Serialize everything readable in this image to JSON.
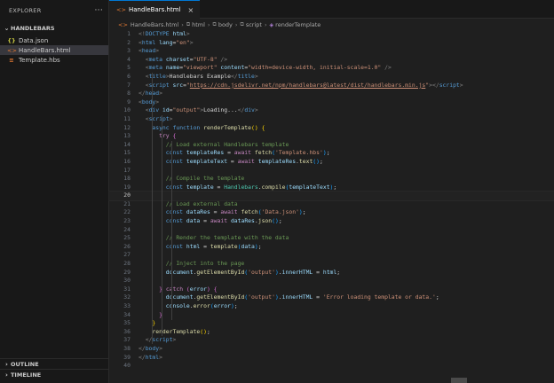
{
  "explorer": {
    "title": "EXPLORER",
    "more": "···",
    "folder": "HANDLEBARS",
    "files": [
      {
        "name": "Data.json",
        "icon": "{}",
        "kind": "json"
      },
      {
        "name": "HandleBars.html",
        "icon": "<>",
        "kind": "html"
      },
      {
        "name": "Template.hbs",
        "icon": "≡",
        "kind": "hbs"
      }
    ],
    "outline": "OUTLINE",
    "timeline": "TIMELINE"
  },
  "tab": {
    "label": "HandleBars.html",
    "icon": "<>",
    "close": "×"
  },
  "breadcrumb": [
    "HandleBars.html",
    "html",
    "body",
    "script",
    "renderTemplate"
  ],
  "current_line": 20,
  "code": [
    [
      [
        "br",
        "<!"
      ],
      [
        "tag",
        "DOCTYPE"
      ],
      [
        "pn",
        " "
      ],
      [
        "attr",
        "html"
      ],
      [
        "br",
        ">"
      ]
    ],
    [
      [
        "br",
        "<"
      ],
      [
        "tag",
        "html"
      ],
      [
        "pn",
        " "
      ],
      [
        "attr",
        "lang"
      ],
      [
        "pn",
        "="
      ],
      [
        "str",
        "\"en\""
      ],
      [
        "br",
        ">"
      ]
    ],
    [
      [
        "br",
        "<"
      ],
      [
        "tag",
        "head"
      ],
      [
        "br",
        ">"
      ]
    ],
    [
      [
        "pn",
        "  "
      ],
      [
        "br",
        "<"
      ],
      [
        "tag",
        "meta"
      ],
      [
        "pn",
        " "
      ],
      [
        "attr",
        "charset"
      ],
      [
        "pn",
        "="
      ],
      [
        "str",
        "\"UTF-8\""
      ],
      [
        "pn",
        " "
      ],
      [
        "br",
        "/>"
      ]
    ],
    [
      [
        "pn",
        "  "
      ],
      [
        "br",
        "<"
      ],
      [
        "tag",
        "meta"
      ],
      [
        "pn",
        " "
      ],
      [
        "attr",
        "name"
      ],
      [
        "pn",
        "="
      ],
      [
        "str",
        "\"viewport\""
      ],
      [
        "pn",
        " "
      ],
      [
        "attr",
        "content"
      ],
      [
        "pn",
        "="
      ],
      [
        "str",
        "\"width=device-width, initial-scale=1.0\""
      ],
      [
        "pn",
        " "
      ],
      [
        "br",
        "/>"
      ]
    ],
    [
      [
        "pn",
        "  "
      ],
      [
        "br",
        "<"
      ],
      [
        "tag",
        "title"
      ],
      [
        "br",
        ">"
      ],
      [
        "pn",
        "Handlebars Example"
      ],
      [
        "br",
        "</"
      ],
      [
        "tag",
        "title"
      ],
      [
        "br",
        ">"
      ]
    ],
    [
      [
        "pn",
        "  "
      ],
      [
        "br",
        "<"
      ],
      [
        "tag",
        "script"
      ],
      [
        "pn",
        " "
      ],
      [
        "attr",
        "src"
      ],
      [
        "pn",
        "="
      ],
      [
        "str",
        "\""
      ],
      [
        "lnk",
        "https://cdn.jsdelivr.net/npm/handlebars@latest/dist/handlebars.min.js"
      ],
      [
        "str",
        "\""
      ],
      [
        "br",
        ">"
      ],
      [
        "br",
        "</"
      ],
      [
        "tag",
        "script"
      ],
      [
        "br",
        ">"
      ]
    ],
    [
      [
        "br",
        "</"
      ],
      [
        "tag",
        "head"
      ],
      [
        "br",
        ">"
      ]
    ],
    [
      [
        "br",
        "<"
      ],
      [
        "tag",
        "body"
      ],
      [
        "br",
        ">"
      ]
    ],
    [
      [
        "pn",
        "  "
      ],
      [
        "br",
        "<"
      ],
      [
        "tag",
        "div"
      ],
      [
        "pn",
        " "
      ],
      [
        "attr",
        "id"
      ],
      [
        "pn",
        "="
      ],
      [
        "str",
        "\"output\""
      ],
      [
        "br",
        ">"
      ],
      [
        "pn",
        "Loading..."
      ],
      [
        "br",
        "</"
      ],
      [
        "tag",
        "div"
      ],
      [
        "br",
        ">"
      ]
    ],
    [
      [
        "pn",
        "  "
      ],
      [
        "br",
        "<"
      ],
      [
        "tag",
        "script"
      ],
      [
        "br",
        ">"
      ]
    ],
    [
      [
        "pn",
        "    "
      ],
      [
        "kw",
        "async"
      ],
      [
        "pn",
        " "
      ],
      [
        "kw",
        "function"
      ],
      [
        "pn",
        " "
      ],
      [
        "fn",
        "renderTemplate"
      ],
      [
        "y",
        "()"
      ],
      [
        "pn",
        " "
      ],
      [
        "y",
        "{"
      ]
    ],
    [
      [
        "pn",
        "      "
      ],
      [
        "ctl",
        "try"
      ],
      [
        "pn",
        " "
      ],
      [
        "p",
        "{"
      ]
    ],
    [
      [
        "pn",
        "        "
      ],
      [
        "com",
        "// Load external Handlebars template"
      ]
    ],
    [
      [
        "pn",
        "        "
      ],
      [
        "kw",
        "const"
      ],
      [
        "pn",
        " "
      ],
      [
        "var",
        "templateRes"
      ],
      [
        "pn",
        " = "
      ],
      [
        "ctl",
        "await"
      ],
      [
        "pn",
        " "
      ],
      [
        "fn",
        "fetch"
      ],
      [
        "b",
        "("
      ],
      [
        "str",
        "'Template.hbs'"
      ],
      [
        "b",
        ")"
      ],
      [
        "pn",
        ";"
      ]
    ],
    [
      [
        "pn",
        "        "
      ],
      [
        "kw",
        "const"
      ],
      [
        "pn",
        " "
      ],
      [
        "var",
        "templateText"
      ],
      [
        "pn",
        " = "
      ],
      [
        "ctl",
        "await"
      ],
      [
        "pn",
        " "
      ],
      [
        "var",
        "templateRes"
      ],
      [
        "pn",
        "."
      ],
      [
        "fn",
        "text"
      ],
      [
        "b",
        "()"
      ],
      [
        "pn",
        ";"
      ]
    ],
    [
      [
        "pn",
        ""
      ]
    ],
    [
      [
        "pn",
        "        "
      ],
      [
        "com",
        "// Compile the template"
      ]
    ],
    [
      [
        "pn",
        "        "
      ],
      [
        "kw",
        "const"
      ],
      [
        "pn",
        " "
      ],
      [
        "var",
        "template"
      ],
      [
        "pn",
        " = "
      ],
      [
        "cls",
        "Handlebars"
      ],
      [
        "pn",
        "."
      ],
      [
        "fn",
        "compile"
      ],
      [
        "b",
        "("
      ],
      [
        "var",
        "templateText"
      ],
      [
        "b",
        ")"
      ],
      [
        "pn",
        ";"
      ]
    ],
    [
      [
        "pn",
        ""
      ]
    ],
    [
      [
        "pn",
        "        "
      ],
      [
        "com",
        "// Load external data"
      ]
    ],
    [
      [
        "pn",
        "        "
      ],
      [
        "kw",
        "const"
      ],
      [
        "pn",
        " "
      ],
      [
        "var",
        "dataRes"
      ],
      [
        "pn",
        " = "
      ],
      [
        "ctl",
        "await"
      ],
      [
        "pn",
        " "
      ],
      [
        "fn",
        "fetch"
      ],
      [
        "b",
        "("
      ],
      [
        "str",
        "'Data.json'"
      ],
      [
        "b",
        ")"
      ],
      [
        "pn",
        ";"
      ]
    ],
    [
      [
        "pn",
        "        "
      ],
      [
        "kw",
        "const"
      ],
      [
        "pn",
        " "
      ],
      [
        "var",
        "data"
      ],
      [
        "pn",
        " = "
      ],
      [
        "ctl",
        "await"
      ],
      [
        "pn",
        " "
      ],
      [
        "var",
        "dataRes"
      ],
      [
        "pn",
        "."
      ],
      [
        "fn",
        "json"
      ],
      [
        "b",
        "()"
      ],
      [
        "pn",
        ";"
      ]
    ],
    [
      [
        "pn",
        ""
      ]
    ],
    [
      [
        "pn",
        "        "
      ],
      [
        "com",
        "// Render the template with the data"
      ]
    ],
    [
      [
        "pn",
        "        "
      ],
      [
        "kw",
        "const"
      ],
      [
        "pn",
        " "
      ],
      [
        "var",
        "html"
      ],
      [
        "pn",
        " = "
      ],
      [
        "fn",
        "template"
      ],
      [
        "b",
        "("
      ],
      [
        "var",
        "data"
      ],
      [
        "b",
        ")"
      ],
      [
        "pn",
        ";"
      ]
    ],
    [
      [
        "pn",
        ""
      ]
    ],
    [
      [
        "pn",
        "        "
      ],
      [
        "com",
        "// Inject into the page"
      ]
    ],
    [
      [
        "pn",
        "        "
      ],
      [
        "var",
        "document"
      ],
      [
        "pn",
        "."
      ],
      [
        "fn",
        "getElementById"
      ],
      [
        "b",
        "("
      ],
      [
        "str",
        "'output'"
      ],
      [
        "b",
        ")"
      ],
      [
        "pn",
        "."
      ],
      [
        "var",
        "innerHTML"
      ],
      [
        "pn",
        " = "
      ],
      [
        "var",
        "html"
      ],
      [
        "pn",
        ";"
      ]
    ],
    [
      [
        "pn",
        ""
      ]
    ],
    [
      [
        "pn",
        "      "
      ],
      [
        "p",
        "}"
      ],
      [
        "pn",
        " "
      ],
      [
        "ctl",
        "catch"
      ],
      [
        "pn",
        " "
      ],
      [
        "p",
        "("
      ],
      [
        "var",
        "error"
      ],
      [
        "p",
        ")"
      ],
      [
        "pn",
        " "
      ],
      [
        "p",
        "{"
      ]
    ],
    [
      [
        "pn",
        "        "
      ],
      [
        "var",
        "document"
      ],
      [
        "pn",
        "."
      ],
      [
        "fn",
        "getElementById"
      ],
      [
        "b",
        "("
      ],
      [
        "str",
        "'output'"
      ],
      [
        "b",
        ")"
      ],
      [
        "pn",
        "."
      ],
      [
        "var",
        "innerHTML"
      ],
      [
        "pn",
        " = "
      ],
      [
        "str",
        "'Error loading template or data.'"
      ],
      [
        "pn",
        ";"
      ]
    ],
    [
      [
        "pn",
        "        "
      ],
      [
        "var",
        "console"
      ],
      [
        "pn",
        "."
      ],
      [
        "fn",
        "error"
      ],
      [
        "b",
        "("
      ],
      [
        "var",
        "error"
      ],
      [
        "b",
        ")"
      ],
      [
        "pn",
        ";"
      ]
    ],
    [
      [
        "pn",
        "      "
      ],
      [
        "p",
        "}"
      ]
    ],
    [
      [
        "pn",
        "    "
      ],
      [
        "y",
        "}"
      ]
    ],
    [
      [
        "pn",
        "    "
      ],
      [
        "fn",
        "renderTemplate"
      ],
      [
        "y",
        "()"
      ],
      [
        "pn",
        ";"
      ]
    ],
    [
      [
        "pn",
        "  "
      ],
      [
        "br",
        "</"
      ],
      [
        "tag",
        "script"
      ],
      [
        "br",
        ">"
      ]
    ],
    [
      [
        "br",
        "</"
      ],
      [
        "tag",
        "body"
      ],
      [
        "br",
        ">"
      ]
    ],
    [
      [
        "br",
        "</"
      ],
      [
        "tag",
        "html"
      ],
      [
        "br",
        ">"
      ]
    ],
    [
      [
        "pn",
        ""
      ]
    ]
  ]
}
